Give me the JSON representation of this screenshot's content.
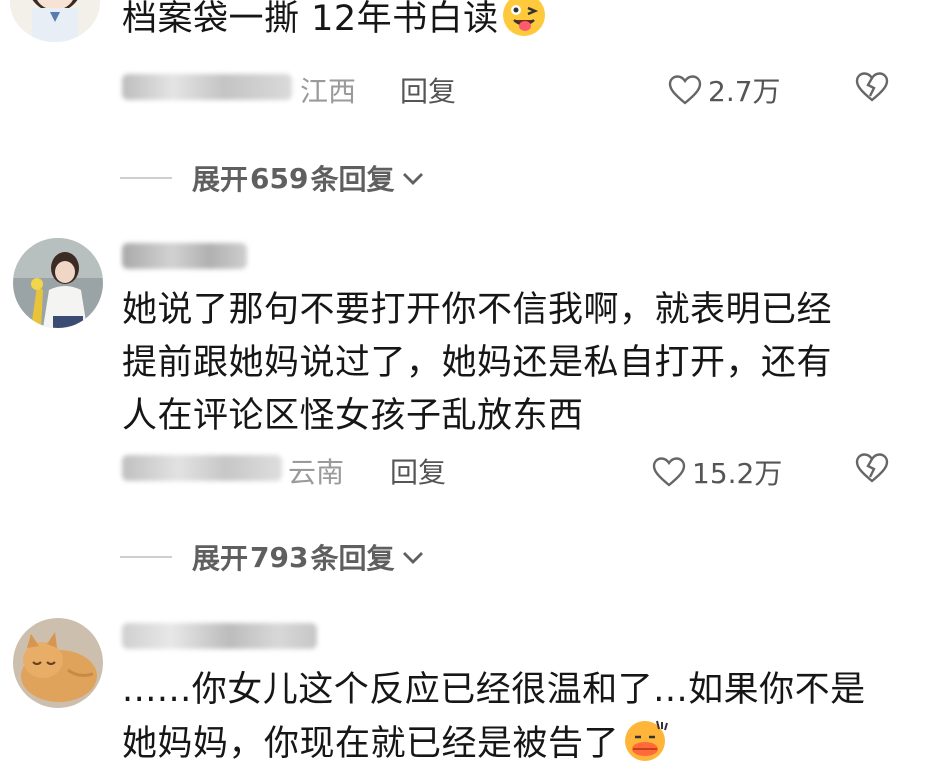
{
  "comments": [
    {
      "text": "档案袋一撕 12年书白读",
      "emoji": "winking-tongue-emoji",
      "location": "江西",
      "reply_label": "回复",
      "likes": "2.7万",
      "expand": {
        "prefix": "展开",
        "count": "659",
        "suffix": "条回复"
      }
    },
    {
      "text": "她说了那句不要打开你不信我啊，就表明已经提前跟她妈说过了，她妈还是私自打开，还有人在评论区怪女孩子乱放东西",
      "location": "云南",
      "reply_label": "回复",
      "likes": "15.2万",
      "expand": {
        "prefix": "展开",
        "count": "793",
        "suffix": "条回复"
      }
    },
    {
      "text": "......你女儿这个反应已经很温和了...如果你不是她妈妈，你现在就已经是被告了",
      "emoji": "speechless-duck-lips-emoji"
    }
  ],
  "colors": {
    "text": "#161616",
    "meta": "#9a9a9a",
    "action": "#555555"
  }
}
